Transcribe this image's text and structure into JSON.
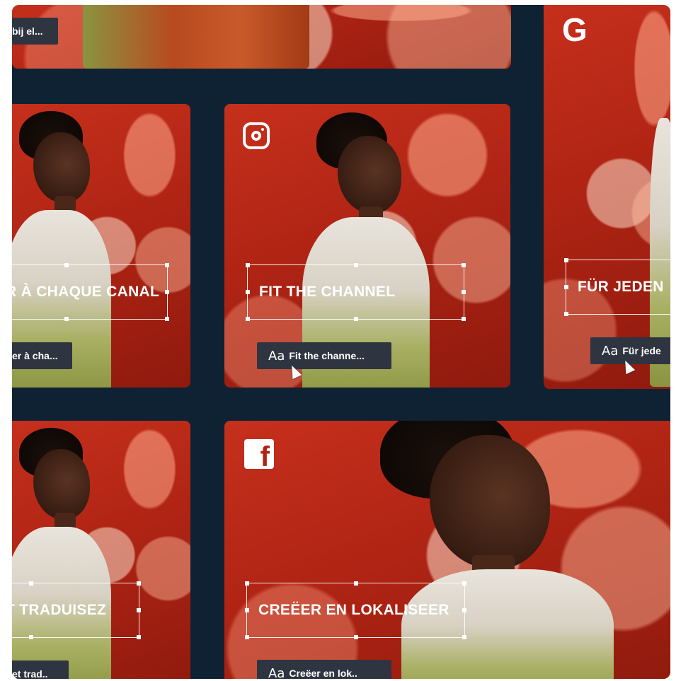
{
  "cards": {
    "top_left": {
      "chip_text": "bij el..."
    },
    "mid_left": {
      "headline": "R À CHAQUE CANAL",
      "chip_text": "er à cha..."
    },
    "mid_center": {
      "headline": "FIT THE CHANNEL",
      "chip_aa": "Aa",
      "chip_text": "Fit the channe...",
      "platform_icon": "instagram-icon"
    },
    "mid_right": {
      "headline": "FÜR JEDEN",
      "chip_aa": "Aa",
      "chip_text": "Für jede",
      "platform_icon": "google-icon",
      "g_glyph": "G"
    },
    "bottom_left": {
      "headline": "T TRADUISEZ",
      "chip_text": "et trad.."
    },
    "bottom_center": {
      "headline": "CREËER EN LOKALISEER",
      "chip_aa": "Aa",
      "chip_text": "Creëer en lok..",
      "platform_icon": "facebook-icon",
      "fb_glyph": "f"
    }
  },
  "colors": {
    "background": "#0f2233",
    "photo_red": "#b02414",
    "chip_bg": "#2f3540",
    "text": "#ffffff"
  }
}
